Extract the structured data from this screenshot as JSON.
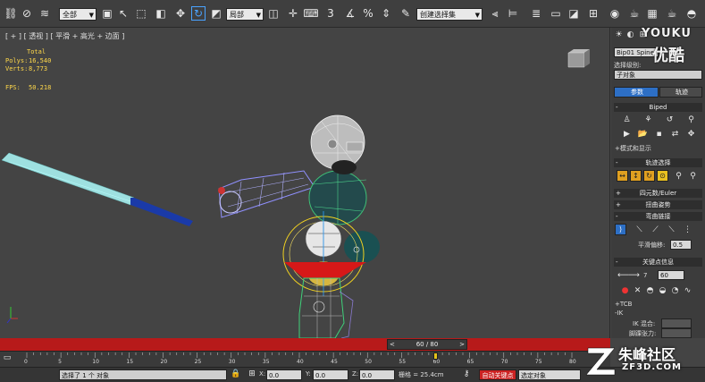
{
  "toolbar": {
    "selection_filter": "全部",
    "ref_coord": "局部",
    "named_selection": "创建选择集",
    "snap_value": "3",
    "icons": [
      "link-icon",
      "unlink-icon",
      "bind-space-warp-icon",
      "select-filter-dropdown",
      "select-object-icon",
      "select-by-name-icon",
      "rect-region-icon",
      "window-crossing-icon",
      "move-icon",
      "rotate-icon",
      "scale-icon",
      "ref-coord-dropdown",
      "pivot-icon",
      "select-manipulate-icon",
      "keyboard-shortcut-icon",
      "snap-toggle-icon",
      "angle-snap-icon",
      "percent-snap-icon",
      "spinner-snap-icon",
      "edit-named-sel-icon",
      "named-sel-dropdown",
      "mirror-icon",
      "align-icon",
      "layer-manager-icon",
      "graphite-icon",
      "curve-editor-icon",
      "schematic-view-icon",
      "material-editor-icon",
      "render-setup-icon",
      "rendered-frame-icon",
      "render-icon"
    ]
  },
  "viewport": {
    "label": "[ + ] [ 透视 ] [ 平滑 + 高光 + 边面 ]",
    "stats": {
      "total_label": "Total",
      "polys_label": "Polys:",
      "polys_value": "16,540",
      "verts_label": "Verts:",
      "verts_value": "8,773",
      "fps_label": "FPS:",
      "fps_value": "50.218"
    }
  },
  "panel": {
    "object_name": "Bip01 Spine",
    "sel_level_label": "选择级别:",
    "sel_level_value": "子对象",
    "tab_params": "参数",
    "tab_track": "轨迹",
    "biped_rollout": "Biped",
    "mode_display": "模式和显示",
    "track_sel_rollout": "轨迹选择",
    "quaternion_rollout": "四元数/Euler",
    "twist_rollout": "扭曲姿势",
    "bend_rollout": "弯曲链接",
    "smooth_bias_label": "平滑偏移:",
    "smooth_bias_value": "0.5",
    "key_info_rollout": "关键点信息",
    "key_index": "7",
    "key_frame": "60",
    "tcb_label": "TCB",
    "ik_label": "IK",
    "ik_blend_label": "IK 混合:",
    "ankle_tension_label": "脚踝张力:"
  },
  "timeline": {
    "slider_text": "60 / 80",
    "prev_arrow": "<",
    "next_arrow": ">",
    "ticks": [
      "0",
      "5",
      "10",
      "15",
      "20",
      "25",
      "30",
      "35",
      "40",
      "45",
      "50",
      "55",
      "60",
      "65",
      "70",
      "75",
      "80"
    ],
    "current_frame": 60
  },
  "status": {
    "selected_text": "选择了 1 个 对象",
    "x_label": "X:",
    "x_value": "0.0",
    "y_label": "Y:",
    "y_value": "0.0",
    "z_label": "Z:",
    "z_value": "0.0",
    "grid_text": "栅格 = 25.4cm",
    "auto_key": "自动关键点",
    "set_key_filter": "选定对象"
  },
  "watermarks": {
    "youku_en": "YOUKU",
    "youku_cn": "优酷",
    "zf_cn": "朱峰社区",
    "zf_en": "ZF3D.COM"
  },
  "colors": {
    "timebar": "#b71a1a",
    "bat": "#9ee0e0",
    "bat_handle": "#1a3aa8",
    "active_tab": "#2d6fc5",
    "key_marker": "#e3c21a"
  }
}
